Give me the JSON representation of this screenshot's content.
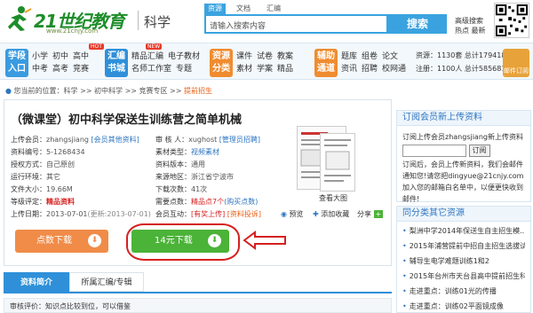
{
  "header": {
    "brand": "21世纪教育",
    "url": "www.21cnjy.com",
    "subject": "科学",
    "search_tabs": [
      "资源",
      "文档",
      "汇编"
    ],
    "search_placeholder": "请输入搜索内容",
    "search_button": "搜索",
    "adv_search": "高级搜索",
    "hot_latest": "热点 最新"
  },
  "nav": {
    "entry": [
      "学段",
      "入口"
    ],
    "grades": [
      "小学",
      "初中",
      "高中",
      "中考",
      "高考",
      "竞赛"
    ],
    "hot_badge": "HOT",
    "huibian": [
      "汇编",
      "书城"
    ],
    "group1": [
      "精品汇编",
      "电子教材",
      "名师工作室",
      "专题"
    ],
    "new_badge": "NEW",
    "resource_cat": [
      "资源",
      "分类"
    ],
    "group2": [
      "课件",
      "试卷",
      "教案",
      "素材",
      "学案",
      "精品"
    ],
    "assist": [
      "辅助",
      "通道"
    ],
    "group3": [
      "题库",
      "组卷",
      "论文",
      "资讯",
      "招聘",
      "校网通"
    ],
    "stats": [
      "资源：1130套",
      "总计1794186套",
      "注册：1100人",
      "总计5856810人"
    ],
    "mail": "邮件订阅"
  },
  "breadcrumb": {
    "prefix": "您当前的位置：科学 >> 初中科学 >> 竞赛专区 >>",
    "current": "提前招生"
  },
  "resource": {
    "title": "（微课堂）初中科学保送生训练营之简单机械",
    "left": [
      {
        "k": "上传会员：",
        "v": "zhangsjiang",
        "x": "[会员其他资料]"
      },
      {
        "k": "资料编号：",
        "v": "5-1268434"
      },
      {
        "k": "授权方式：",
        "v": "自己原创"
      },
      {
        "k": "运行环境：",
        "v": "其它"
      },
      {
        "k": "文件大小：",
        "v": "19.66M"
      },
      {
        "k": "等级评定：",
        "v": "精品资料"
      },
      {
        "k": "上传日期：",
        "v": "2013-07-01",
        "x": "(更新:2013-07-01)"
      }
    ],
    "right": [
      {
        "k": "审 核 人：",
        "v": "xughost",
        "x": "[管理员招聘]"
      },
      {
        "k": "素材类型：",
        "v": "视频素材"
      },
      {
        "k": "资料版本：",
        "v": "通用"
      },
      {
        "k": "来源地区：",
        "v": "浙江省宁波市"
      },
      {
        "k": "下载次数：",
        "v": "41次"
      },
      {
        "k": "需要点数：",
        "v": "精品点7个",
        "x": "(购买点数)"
      },
      {
        "k": "会员互动：",
        "v": "[有奖上传]",
        "x": "[资料投诉]"
      }
    ],
    "preview_label": "查看大图",
    "actions": [
      "预览",
      "添加收藏",
      "分享"
    ],
    "btn_points": "点数下载",
    "btn_pay": "14元下载",
    "tabs": [
      "资料简介",
      "所属汇编/专辑"
    ],
    "eval": "审核评价：知识点比较到位，可以借鉴"
  },
  "sidebar": {
    "sub_title": "订阅会员新上传资料",
    "sub_text1": "订阅上传会员zhangsjiang新上传资料",
    "sub_btn": "订阅",
    "sub_text2": "订阅后，会员上传新资料，我们会邮件通知您!请您把dingyue@21cnjy.com加入您的邮箱白名单中，以便更快收到邮件!",
    "same_title": "同分类其它资源",
    "same_list": [
      "梨洲中学2014年保送生自主招生模...",
      "2015年浦营提前中招自主招生选拔试...",
      "辅导生电学难题训练1和2",
      "2015年台州市天台县高中提前招生科...",
      "走进重点：训练01光的传播",
      "走进重点：训练02平面镜成像"
    ]
  },
  "colors": {
    "accent": "#3aa3df",
    "orange": "#f08c48",
    "green": "#4bb338",
    "red": "#d62020"
  }
}
